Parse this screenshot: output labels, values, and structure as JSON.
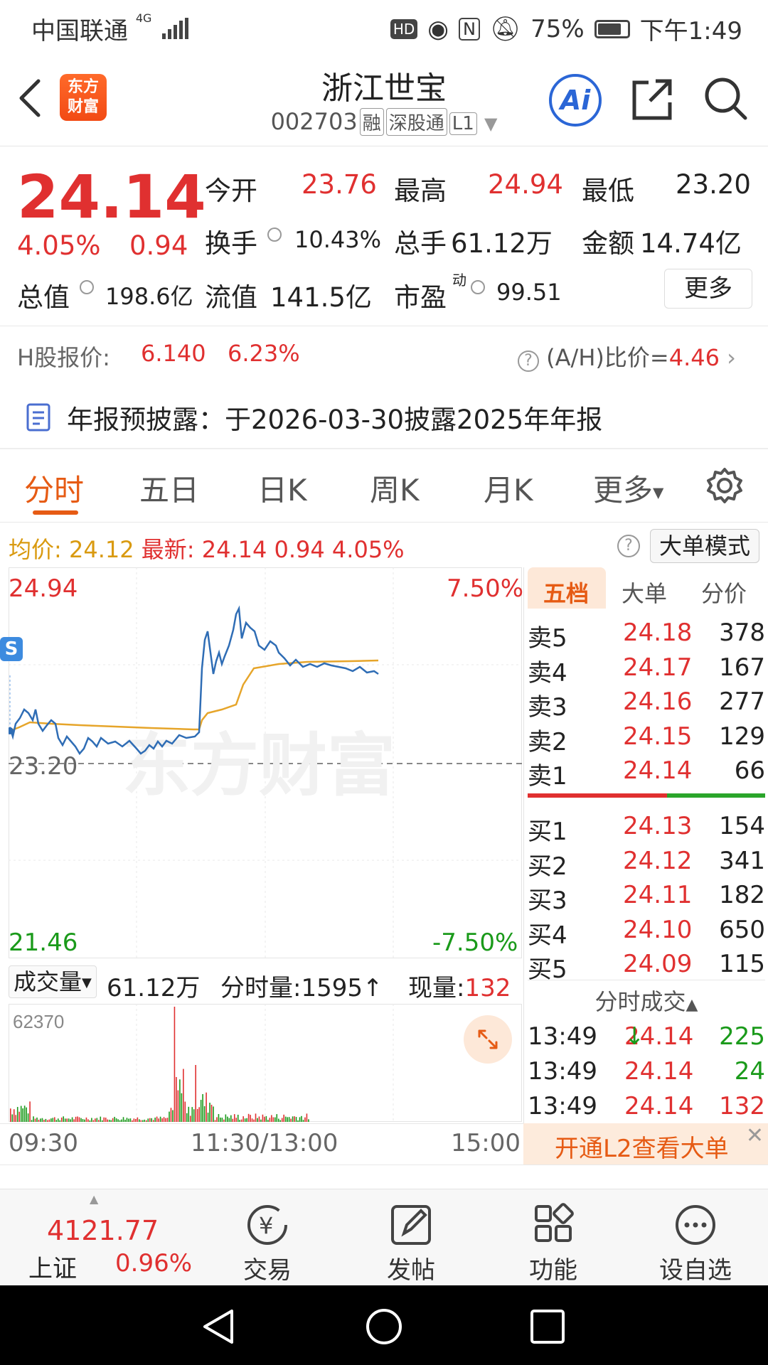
{
  "status_bar": {
    "carrier": "中国联通",
    "net": "4G",
    "battery": "75%",
    "time": "下午1:49",
    "hd": "HD"
  },
  "header": {
    "logo_line1": "东方",
    "logo_line2": "财富",
    "title": "浙江世宝",
    "code": "002703",
    "tags": [
      "融",
      "深股通",
      "L1"
    ]
  },
  "quote": {
    "price": "24.14",
    "change_pct": "4.05%",
    "change": "0.94",
    "open_label": "今开",
    "open": "23.76",
    "high_label": "最高",
    "high": "24.94",
    "low_label": "最低",
    "low": "23.20",
    "turnover_label": "换手",
    "turnover": "10.43%",
    "volume_label": "总手",
    "volume": "61.12万",
    "amount_label": "金额",
    "amount": "14.74亿",
    "mktcap_label": "总值",
    "mktcap": "198.6亿",
    "float_label": "流值",
    "float": "141.5亿",
    "pe_label": "市盈",
    "pe_sup": "动",
    "pe": "99.51",
    "more": "更多"
  },
  "hshare": {
    "label": "H股报价:",
    "price": "6.140",
    "pct": "6.23%",
    "ratio_label": "(A/H)比价=",
    "ratio": "4.46"
  },
  "notice": {
    "text": "年报预披露：于2026-03-30披露2025年年报"
  },
  "tabs": [
    "分时",
    "五日",
    "日K",
    "周K",
    "月K",
    "更多"
  ],
  "chart_bar": {
    "avg_label": "均价:",
    "avg": "24.12",
    "latest_label": "最新:",
    "latest": "24.14",
    "chg": "0.94",
    "pct": "4.05%",
    "mode_btn": "大单模式"
  },
  "chart_labels": {
    "top": "24.94",
    "top_pct": "7.50%",
    "bottom": "21.46",
    "bottom_pct": "-7.50%",
    "ref": "23.20",
    "watermark": "东方财富",
    "s_badge": "S"
  },
  "volume_bar": {
    "label": "成交量",
    "total": "61.12万",
    "tick_label": "分时量:1595",
    "tick_arrow": "↑",
    "now_label": "现量:",
    "now": "132",
    "max": "62370"
  },
  "time_axis": [
    "09:30",
    "11:30/13:00",
    "15:00"
  ],
  "orderbook": {
    "tabs": [
      "五档",
      "大单",
      "分价"
    ],
    "sells": [
      {
        "label": "卖5",
        "price": "24.18",
        "qty": "378"
      },
      {
        "label": "卖4",
        "price": "24.17",
        "qty": "167"
      },
      {
        "label": "卖3",
        "price": "24.16",
        "qty": "277"
      },
      {
        "label": "卖2",
        "price": "24.15",
        "qty": "129"
      },
      {
        "label": "卖1",
        "price": "24.14",
        "qty": "66"
      }
    ],
    "buys": [
      {
        "label": "买1",
        "price": "24.13",
        "qty": "154"
      },
      {
        "label": "买2",
        "price": "24.12",
        "qty": "341"
      },
      {
        "label": "买3",
        "price": "24.11",
        "qty": "182"
      },
      {
        "label": "买4",
        "price": "24.10",
        "qty": "650"
      },
      {
        "label": "买5",
        "price": "24.09",
        "qty": "115"
      }
    ],
    "trades_title": "分时成交",
    "trades": [
      {
        "time": "13:49",
        "price": "24.14",
        "arrow": "↓",
        "qty": "225"
      },
      {
        "time": "13:49",
        "price": "24.14",
        "arrow": "",
        "qty": "24"
      },
      {
        "time": "13:49",
        "price": "24.14",
        "arrow": "",
        "qty": "132"
      }
    ],
    "l2_banner": "开通L2查看大单"
  },
  "bottom_nav": {
    "index_value": "4121.77",
    "index_name": "上证",
    "index_pct": "0.96%",
    "items": [
      "交易",
      "发帖",
      "功能",
      "设自选"
    ]
  },
  "colors": {
    "up": "#e03030",
    "down": "#1a9a1a",
    "accent": "#e65b14",
    "price_line": "#2f6db5",
    "avg_line": "#e6a52a"
  }
}
